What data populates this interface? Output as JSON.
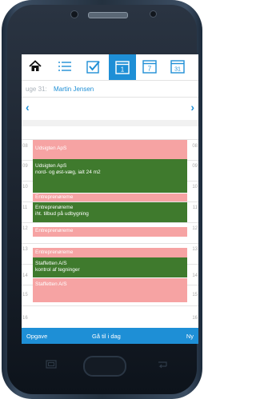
{
  "toolbar": {
    "icons": [
      "home-icon",
      "list-icon",
      "check-icon",
      "calendar-1-icon",
      "calendar-7-icon",
      "calendar-31-icon"
    ],
    "cal1": "1",
    "cal7": "7",
    "cal31": "31"
  },
  "week": {
    "label": "uge 31:",
    "name": "Martin Jensen"
  },
  "nav": {
    "prev": "‹",
    "next": "›"
  },
  "hours": [
    "08",
    "09",
    "10",
    "11",
    "12",
    "13",
    "14",
    "15",
    "16"
  ],
  "events": [
    {
      "title": "Udsigten ApS",
      "detail": ""
    },
    {
      "title": "Udsigten ApS",
      "detail": "nord- og øst-væg, ialt 24 m2"
    },
    {
      "title": "Entreprenøreme",
      "detail": ""
    },
    {
      "title": "Entreprenøreme",
      "detail": "iht. tilbud på udbygning"
    },
    {
      "title": "Entreprenøreme",
      "detail": ""
    },
    {
      "title": "Entreprenøreme",
      "detail": ""
    },
    {
      "title": "Staffetten A/S",
      "detail": "kontrol af tegninger"
    },
    {
      "title": "Staffetten A/S",
      "detail": ""
    }
  ],
  "bottom": {
    "left": "Opgave",
    "center": "Gå til i dag",
    "right": "Ny"
  },
  "colors": {
    "accent": "#1e8fd6",
    "pink": "#f6a3a3",
    "green": "#3f7a2d"
  }
}
